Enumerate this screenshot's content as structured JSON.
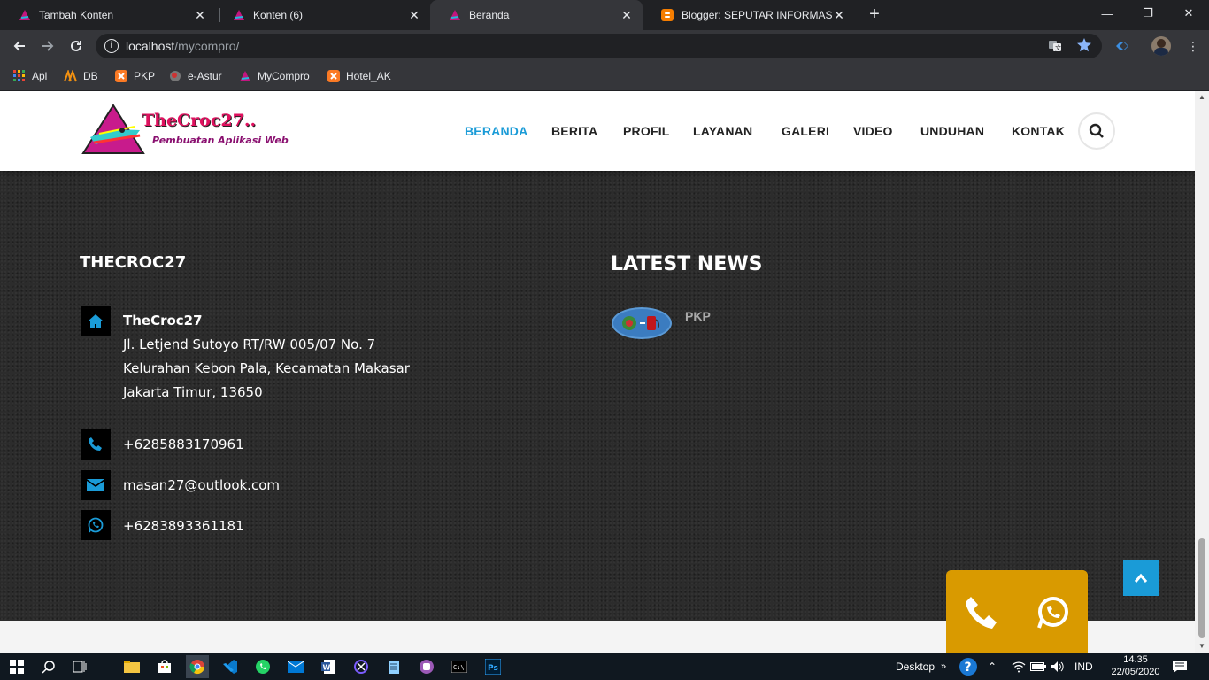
{
  "browser": {
    "tabs": [
      {
        "title": "Tambah Konten",
        "active": false
      },
      {
        "title": "Konten (6)",
        "active": false
      },
      {
        "title": "Beranda",
        "active": true
      },
      {
        "title": "Blogger: SEPUTAR INFORMASI D",
        "active": false
      }
    ],
    "url_host": "localhost",
    "url_path": "/mycompro/",
    "bookmarks": [
      "Apl",
      "DB",
      "PKP",
      "e-Astur",
      "MyCompro",
      "Hotel_AK"
    ]
  },
  "site": {
    "logo_title": "TheCroc27..",
    "logo_subtitle": "Pembuatan Aplikasi Web",
    "nav": [
      "BERANDA",
      "BERITA",
      "PROFIL",
      "LAYANAN",
      "GALERI",
      "VIDEO",
      "UNDUHAN",
      "KONTAK"
    ],
    "active_nav": "BERANDA",
    "accent_color": "#1a9bd7"
  },
  "footer": {
    "company_heading": "THECROC27",
    "company_name": "TheCroc27",
    "address_lines": [
      "Jl. Letjend Sutoyo RT/RW 005/07 No. 7",
      "Kelurahan Kebon Pala, Kecamatan Makasar",
      "Jakarta Timur, 13650"
    ],
    "phone": "+6285883170961",
    "email": "masan27@outlook.com",
    "whatsapp": "+6283893361181",
    "news_heading": "LATEST NEWS",
    "news_items": [
      {
        "title": "PKP"
      }
    ]
  },
  "taskbar": {
    "desktop_label": "Desktop",
    "language": "IND",
    "time": "14.35",
    "date": "22/05/2020"
  }
}
